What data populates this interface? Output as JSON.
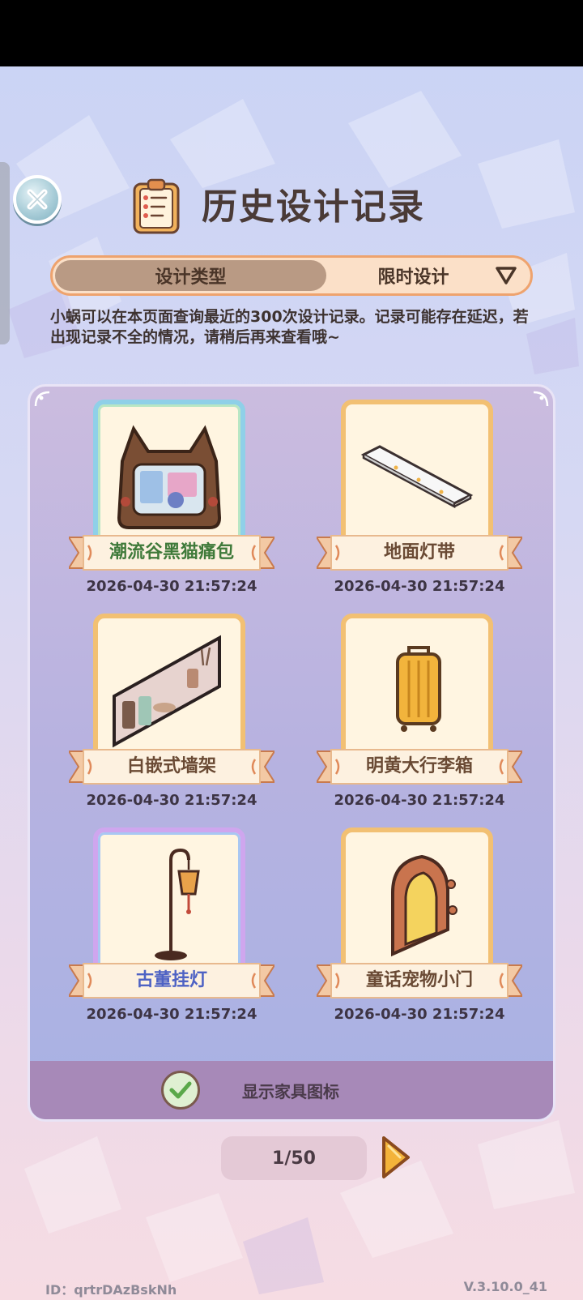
{
  "header": {
    "title": "历史设计记录",
    "close_icon": "close-icon",
    "title_icon": "clipboard-icon"
  },
  "type_bar": {
    "label": "设计类型",
    "selected": "限时设计",
    "dropdown_icon": "triangle-down-icon"
  },
  "notice": "小蜗可以在本页面查询最近的300次设计记录。记录可能存在延迟，若出现记录不全的情况，请稍后再来查看哦~",
  "items": [
    {
      "name": "潮流谷黑猫痛包",
      "date": "2026-04-30 21:57:24",
      "frame": "blue",
      "name_color": "green",
      "icon": "cat-bag-icon"
    },
    {
      "name": "地面灯带",
      "date": "2026-04-30 21:57:24",
      "frame": "gold",
      "name_color": "brown",
      "icon": "floor-light-strip-icon"
    },
    {
      "name": "白嵌式墙架",
      "date": "2026-04-30 21:57:24",
      "frame": "gold",
      "name_color": "brown",
      "icon": "wall-shelf-icon"
    },
    {
      "name": "明黄大行李箱",
      "date": "2026-04-30 21:57:24",
      "frame": "gold",
      "name_color": "brown",
      "icon": "suitcase-icon"
    },
    {
      "name": "古董挂灯",
      "date": "2026-04-30 21:57:24",
      "frame": "purple",
      "name_color": "blue",
      "icon": "hanging-lamp-icon"
    },
    {
      "name": "童话宠物小门",
      "date": "2026-04-30 21:57:24",
      "frame": "gold",
      "name_color": "brown",
      "icon": "pet-door-icon"
    }
  ],
  "footer": {
    "checkbox_checked": true,
    "label": "显示家具图标"
  },
  "pagination": {
    "current": "1/50",
    "next_icon": "play-right-icon"
  },
  "meta": {
    "user_id": "ID：qrtrDAzBskNh",
    "version": "V.3.10.0_41"
  },
  "colors": {
    "accent_orange": "#eea36e",
    "frame_gold": "#f2c073",
    "panel_purple": "#b7b2e0",
    "footer_purple": "#a789b8",
    "check_green": "#5aa84a"
  }
}
